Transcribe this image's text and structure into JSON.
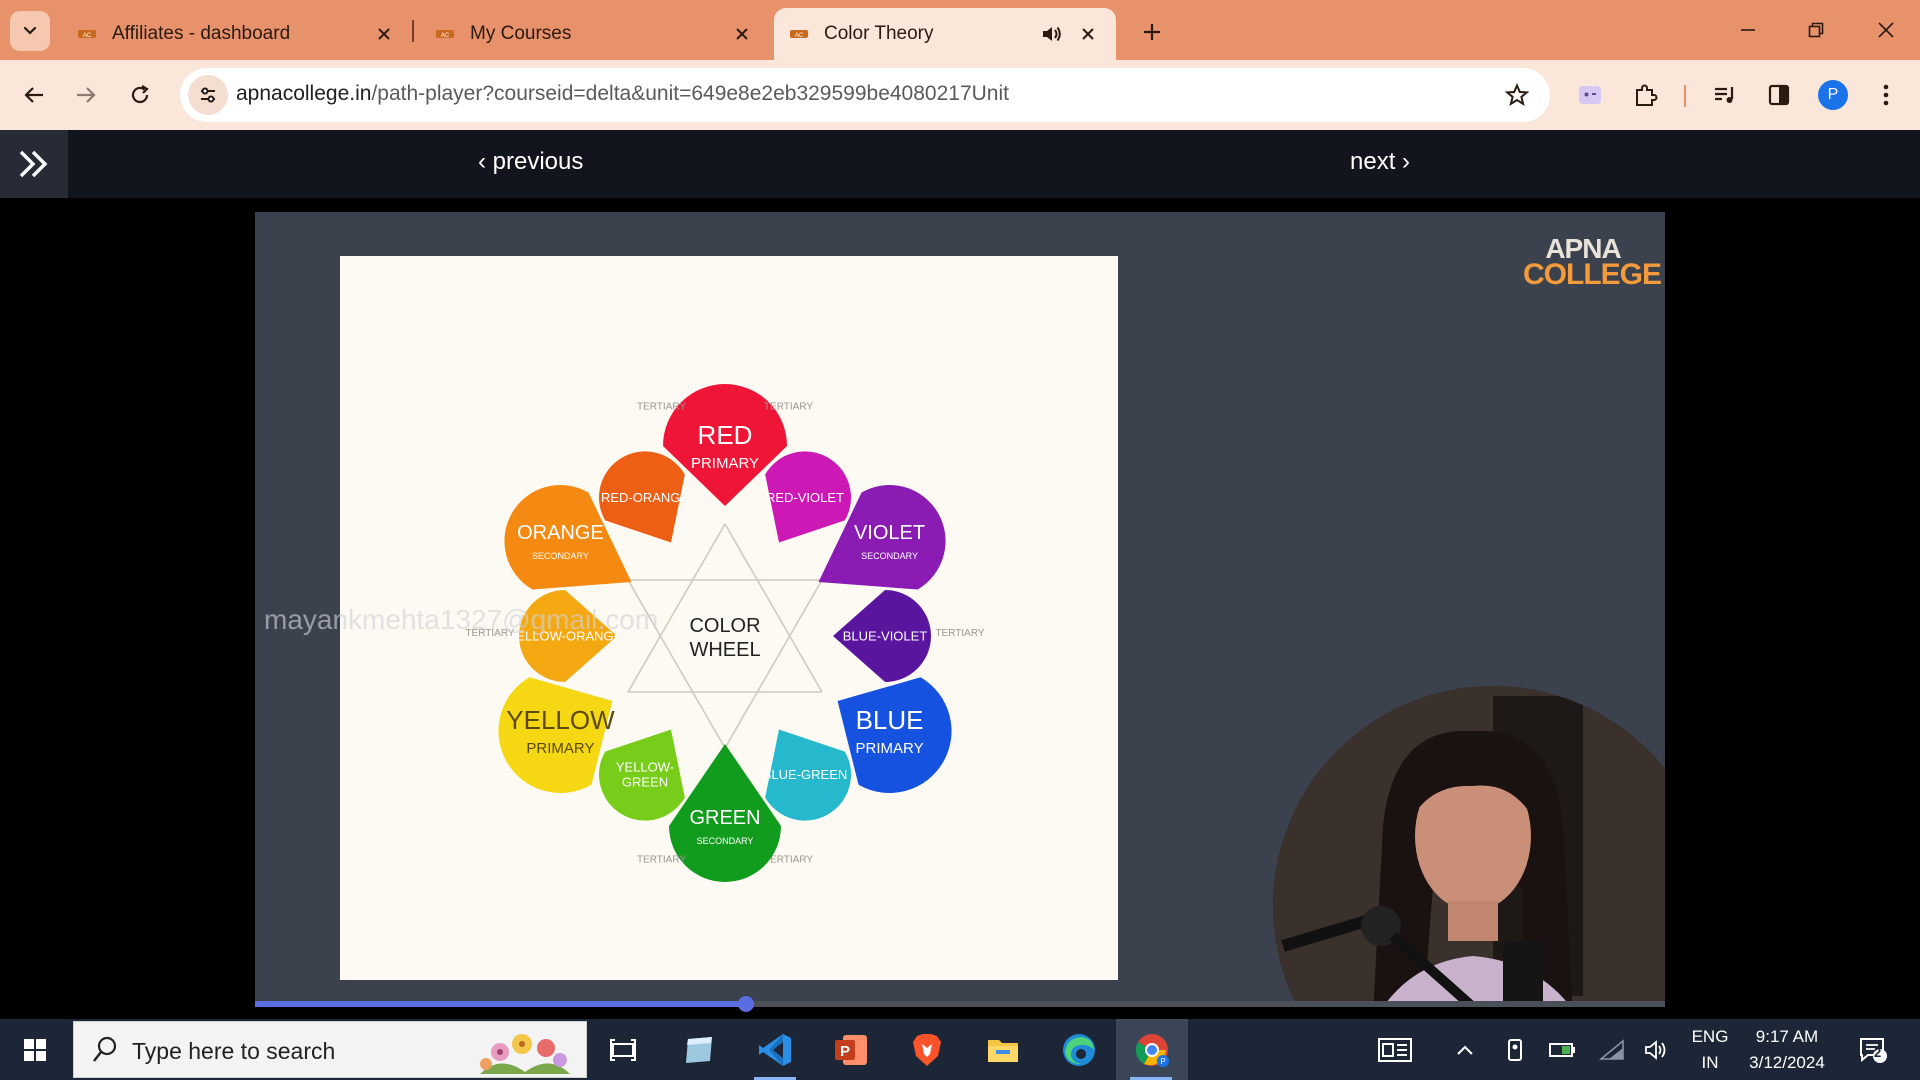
{
  "browser": {
    "tabs": [
      {
        "title": "Affiliates - dashboard",
        "active": false
      },
      {
        "title": "My Courses",
        "active": false
      },
      {
        "title": "Color Theory",
        "active": true,
        "audio": true
      }
    ],
    "url_host": "apnacollege.in",
    "url_path": "/path-player?courseid=delta&unit=649e8e2eb329599be4080217Unit",
    "profile_initial": "P",
    "theme_color": "#e8926c"
  },
  "player": {
    "previous_label": "‹ previous",
    "next_label": "next ›",
    "logo_line1": "APNA",
    "logo_line2": "COLLEGE",
    "watermark": "mayankmehta1327@gmail.com",
    "progress_fraction": 0.348,
    "accent_color": "#5b6ee1"
  },
  "color_wheel": {
    "center_line1": "COLOR",
    "center_line2": "WHEEL",
    "petals": [
      {
        "name": "RED",
        "sub": "PRIMARY",
        "color": "#ee1537"
      },
      {
        "name": "RED-VIOLET",
        "sub": "",
        "color": "#cc18b5"
      },
      {
        "name": "VIOLET",
        "sub": "SECONDARY",
        "color": "#8a1bb3"
      },
      {
        "name": "BLUE-VIOLET",
        "sub": "",
        "color": "#5a159e"
      },
      {
        "name": "BLUE",
        "sub": "PRIMARY",
        "color": "#1652e0"
      },
      {
        "name": "BLUE-GREEN",
        "sub": "",
        "color": "#26b8cc"
      },
      {
        "name": "GREEN",
        "sub": "SECONDARY",
        "color": "#129c1e"
      },
      {
        "name": "YELLOW-\nGREEN",
        "sub": "",
        "color": "#78cd1a"
      },
      {
        "name": "YELLOW",
        "sub": "PRIMARY",
        "color": "#f6d713"
      },
      {
        "name": "YELLOW-ORANGE",
        "sub": "",
        "color": "#f4a913"
      },
      {
        "name": "ORANGE",
        "sub": "SECONDARY",
        "color": "#f58a12"
      },
      {
        "name": "RED-ORANGE",
        "sub": "",
        "color": "#ec5f14"
      }
    ],
    "tertiary_label": "TERTIARY"
  },
  "taskbar": {
    "search_placeholder": "Type here to search",
    "lang_line1": "ENG",
    "lang_line2": "IN",
    "time": "9:17 AM",
    "date": "3/12/2024",
    "notification_count": "2",
    "apps": [
      "task-view",
      "notes-app",
      "vscode",
      "powerpoint",
      "brave",
      "file-explorer",
      "edge",
      "chrome"
    ]
  }
}
